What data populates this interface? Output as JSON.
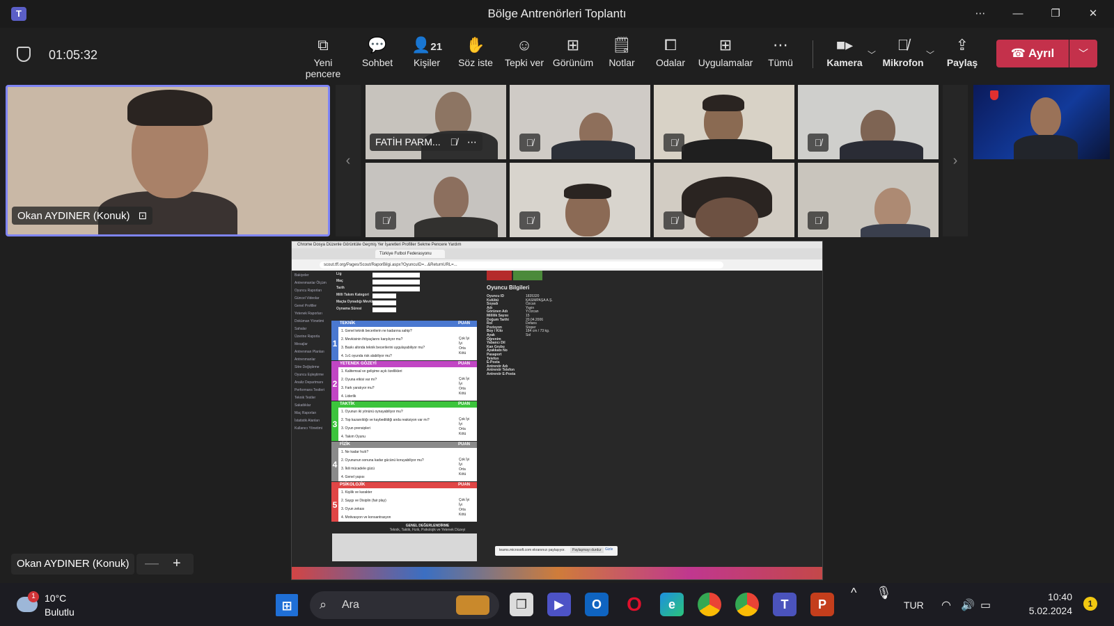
{
  "window": {
    "title": "Bölge Antrenörleri Toplantı"
  },
  "toolbar": {
    "timer": "01:05:32",
    "items": [
      {
        "label": "Yeni pencere",
        "icon": "popout-icon"
      },
      {
        "label": "Sohbet",
        "icon": "chat-icon"
      },
      {
        "label": "Kişiler",
        "icon": "people-icon",
        "count": "21"
      },
      {
        "label": "Söz iste",
        "icon": "raise-hand-icon"
      },
      {
        "label": "Tepki ver",
        "icon": "emoji-icon"
      },
      {
        "label": "Görünüm",
        "icon": "grid-icon"
      },
      {
        "label": "Notlar",
        "icon": "notes-icon"
      },
      {
        "label": "Odalar",
        "icon": "rooms-icon"
      },
      {
        "label": "Uygulamalar",
        "icon": "apps-icon"
      },
      {
        "label": "Tümü",
        "icon": "more-icon"
      }
    ],
    "camera_label": "Kamera",
    "mic_label": "Mikrofon",
    "share_label": "Paylaş",
    "leave_label": "Ayrıl"
  },
  "main_speaker": {
    "name": "Okan AYDINER (Konuk)"
  },
  "participants": [
    {
      "name": "FATİH PARM...",
      "muted": true
    },
    {
      "name": "",
      "muted": true
    },
    {
      "name": "",
      "muted": true
    },
    {
      "name": "",
      "muted": true
    },
    {
      "name": "",
      "muted": true
    },
    {
      "name": "",
      "muted": true
    },
    {
      "name": "",
      "muted": true
    },
    {
      "name": "",
      "muted": true
    }
  ],
  "shared_screen": {
    "menu": "Chrome  Dosya  Düzenle  Görüntüle  Geçmiş  Yer İşaretleri  Profiller  Sekme  Pencere  Yardım",
    "tab_title": "Türkiye Futbol Federasyonu",
    "url": "scout.tff.org/Pages/Scout/RaporBilgi.aspx?OyuncuID=...&ReturnURL=...",
    "sidebar": [
      "Bakiyeler",
      "Antrenmanlar Ölçüm",
      "Oyuncu Raporları",
      "Güncel Videolar",
      "Genel Profiller",
      "Yetenek Raporları",
      "Doküman Yönetimi",
      "Sahalar",
      "Üzerine Raporla",
      "Mesajlar",
      "Antrenman Planları",
      "Antrenmanlar",
      "Sitre Değiştirme",
      "Oyuncu Eşleştirme",
      "Analiz Departmanı",
      "Performans Testleri",
      "Teknik Testler",
      "Sakatlıklar",
      "Maç Raporları",
      "İstatistik Alanları",
      "Kullanıcı Yönetimi"
    ],
    "form_labels": [
      "Lig",
      "Maç",
      "Tarih",
      "Milli Takım Kategori",
      "Maçta Oynadığı Mevki",
      "Oynama Süresi"
    ],
    "sections": [
      {
        "num": "1",
        "title": "TEKNİK",
        "color": "#4a78d0",
        "questions": [
          "1. Genel teknik becerilerin ne kadarına sahip?",
          "2. Mevkisinin ihtiyaçlarını karşılıyor mu?",
          "3. Baskı altında teknik becerilerini uygulayabiliyor mu?",
          "4. 1v1 oyunda risk alabiliyor mu?"
        ]
      },
      {
        "num": "2",
        "title": "YETENEK GÖZEYİ",
        "color": "#c146c4",
        "questions": [
          "1. Kalitemsal ve gelişime açık özellikleri",
          "2. Oyuna etkisi var mı?",
          "3. Fark yaratıyor mu?",
          "4. Liderlik"
        ]
      },
      {
        "num": "3",
        "title": "TAKTİK",
        "color": "#3cc43c",
        "questions": [
          "1. Oyunun iki yönünü oynayabiliyor mu?",
          "2. Top kazanıldığı ve kaybedildiği anda reaksiyon var mı?",
          "3. Oyun prensipleri",
          "4. Takım Oyunu"
        ]
      },
      {
        "num": "4",
        "title": "FİZİK",
        "color": "#8a8a8a",
        "questions": [
          "1. Ne kadar hızlı?",
          "2. Oyununun sonuna kadar gücünü koruyabiliyor mu?",
          "3. İkili mücadele gücü",
          "4. Genel yapısı"
        ]
      },
      {
        "num": "5",
        "title": "PSİKOLOJİK",
        "color": "#e04646",
        "questions": [
          "1. Kişilik ve karakter",
          "2. Saygı ve Disiplin (fair play)",
          "3. Oyun zekası",
          "4. Motivasyon ve konsantrasyon"
        ]
      }
    ],
    "score_label": "PUAN",
    "options": [
      "Çok İyi",
      "İyi",
      "Orta",
      "Kötü"
    ],
    "player_info_title": "Oyuncu Bilgileri",
    "player_info": [
      [
        "Oyuncu ID",
        "1835320"
      ],
      [
        "Kulübü",
        "KASIMPAŞA A.Ş."
      ],
      [
        "Soyadı",
        "Özcan"
      ],
      [
        "Adı",
        "Yasin"
      ],
      [
        "Görünen Adı",
        "Y.Özcan"
      ],
      [
        "Millilik Sayısı",
        "15"
      ],
      [
        "Doğum Tarihi",
        "20.04.2006"
      ],
      [
        "Rol",
        "Defans"
      ],
      [
        "Pozisyon",
        "Stoper"
      ],
      [
        "Boy / Kilo",
        "184 cm / 73 kg."
      ],
      [
        "Ayak",
        "Sol"
      ],
      [
        "Öğrenim",
        ""
      ],
      [
        "Yabancı Dil",
        ""
      ],
      [
        "Kan Grubu",
        ""
      ],
      [
        "Ayakkabı No",
        ""
      ],
      [
        "Pasaport",
        ""
      ],
      [
        "Telefon",
        ""
      ],
      [
        "E-Posta",
        ""
      ],
      [
        "Antrenör Adı",
        ""
      ],
      [
        "Antrenör Telefon",
        ""
      ],
      [
        "Antrenör E-Posta",
        ""
      ]
    ],
    "overall_title": "GENEL DEĞERLENDİRME",
    "overall_sub": "Teknik, Taktik, Fizik, Psikolojik ve Yetenek Düzeyi",
    "share_bar_text": "teams.microsoft.com ekranınızı paylaşıyor.",
    "share_stop": "Paylaşmayı durdur",
    "share_hide": "Gizle"
  },
  "bottom_overlay": {
    "speaker": "Okan AYDINER (Konuk)",
    "zoom_minus": "—",
    "zoom_plus": "+"
  },
  "taskbar": {
    "weather_temp": "10°C",
    "weather_desc": "Bulutlu",
    "weather_badge": "1",
    "search_placeholder": "Ara",
    "lang": "TUR",
    "time": "10:40",
    "date": "5.02.2024",
    "notif_count": "1"
  }
}
